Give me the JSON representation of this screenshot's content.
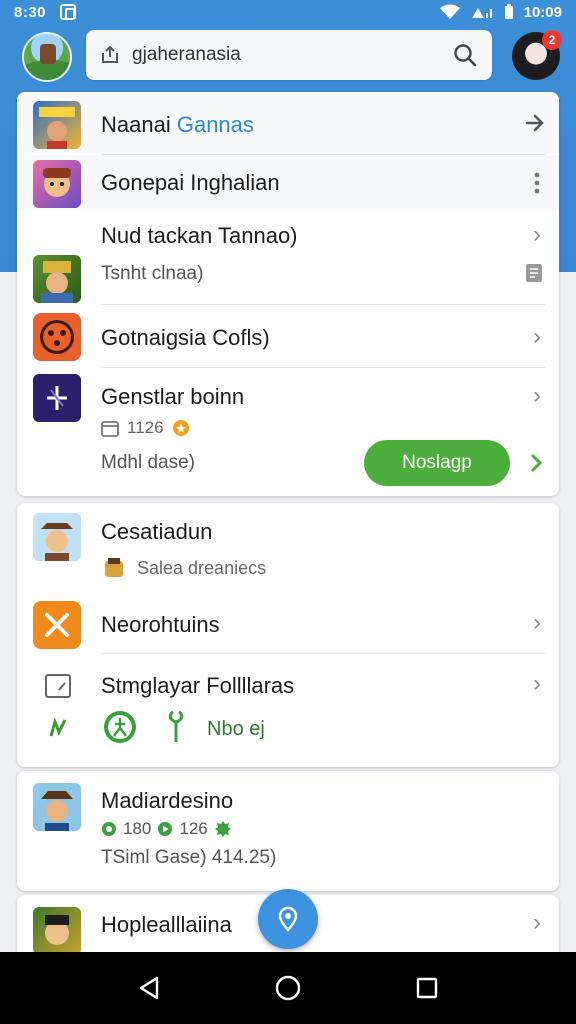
{
  "status_bar": {
    "time_left": "8:30",
    "time_right": "10:09"
  },
  "search": {
    "text": "gjaheranasia"
  },
  "profile": {
    "badge": "2"
  },
  "card1": {
    "rows": [
      {
        "title_main": "Naanai",
        "title_accent": "Gannas"
      },
      {
        "title": "Gonepai Inghalian"
      },
      {
        "title": "Nud tackan Tannao)",
        "subtitle": "Tsnht clnaa)"
      },
      {
        "title": "Gotnaigsia Cofls)"
      },
      {
        "title": "Genstlar boinn",
        "meta": "1126",
        "subtitle": "Mdhl dase)",
        "button": "Noslagp"
      }
    ]
  },
  "card2": {
    "rows": [
      {
        "title": "Cesatiadun",
        "subtitle": "Salea dreaniecs"
      },
      {
        "title": "Neorohtuins"
      },
      {
        "title": "Stmglayar Follllaras",
        "tags_text": "Nbo ej"
      }
    ]
  },
  "card3": {
    "rows": [
      {
        "title": "Madiardesino",
        "stat1": "180",
        "stat2": "126",
        "subtitle": "TSiml Gase) 414.25)"
      }
    ]
  },
  "card4": {
    "rows": [
      {
        "title": "Hoplealllaiina"
      }
    ]
  },
  "colors": {
    "header": "#3b86d2",
    "install": "#4caf3c",
    "fab": "#3d93e0",
    "accent": "#2e8ad6"
  }
}
